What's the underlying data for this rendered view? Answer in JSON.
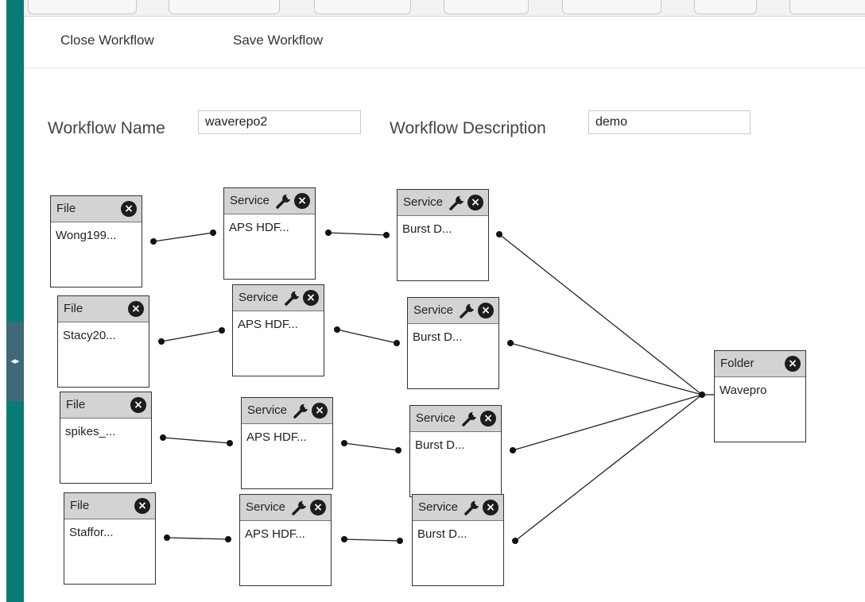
{
  "toolbar": {
    "close_label": "Close Workflow",
    "save_label": "Save Workflow"
  },
  "form": {
    "name_label": "Workflow Name",
    "name_value": "waverepo2",
    "description_label": "Workflow Description",
    "description_value": "demo"
  },
  "icons": {
    "close": "close-icon",
    "configure": "wrench-icon",
    "collapse": "collapse-arrows-icon"
  },
  "nodes": {
    "file_1": {
      "type": "File",
      "label": "Wong199..."
    },
    "service_1a": {
      "type": "Service",
      "label": "APS HDF..."
    },
    "service_1b": {
      "type": "Service",
      "label": "Burst D..."
    },
    "file_2": {
      "type": "File",
      "label": "Stacy20..."
    },
    "service_2a": {
      "type": "Service",
      "label": "APS HDF..."
    },
    "service_2b": {
      "type": "Service",
      "label": "Burst D..."
    },
    "file_3": {
      "type": "File",
      "label": "spikes_..."
    },
    "service_3a": {
      "type": "Service",
      "label": "APS HDF..."
    },
    "service_3b": {
      "type": "Service",
      "label": "Burst D..."
    },
    "file_4": {
      "type": "File",
      "label": "Staffor..."
    },
    "service_4a": {
      "type": "Service",
      "label": "APS HDF..."
    },
    "service_4b": {
      "type": "Service",
      "label": "Burst D..."
    },
    "folder": {
      "type": "Folder",
      "label": "Wavepro"
    }
  }
}
